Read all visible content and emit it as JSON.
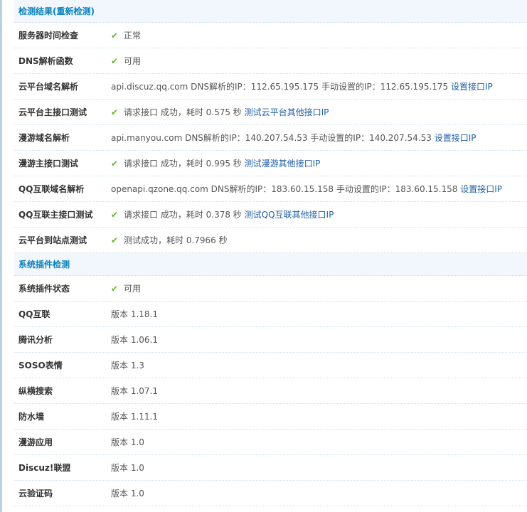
{
  "section1": {
    "title": "检测结果(重新检测)"
  },
  "rows1": [
    {
      "label": "服务器时间检查",
      "ok": true,
      "text": "正常"
    },
    {
      "label": "DNS解析函数",
      "ok": true,
      "text": "可用"
    },
    {
      "label": "云平台域名解析",
      "text": "api.discuz.qq.com DNS解析的IP：112.65.195.175 手动设置的IP：112.65.195.175",
      "link": "设置接口IP"
    },
    {
      "label": "云平台主接口测试",
      "ok": true,
      "text": "请求接口 成功，耗时 0.575 秒",
      "link": "测试云平台其他接口IP"
    },
    {
      "label": "漫游域名解析",
      "text": "api.manyou.com DNS解析的IP：140.207.54.53 手动设置的IP：140.207.54.53",
      "link": "设置接口IP"
    },
    {
      "label": "漫游主接口测试",
      "ok": true,
      "text": "请求接口 成功，耗时 0.995 秒",
      "link": "测试漫游其他接口IP"
    },
    {
      "label": "QQ互联域名解析",
      "text": "openapi.qzone.qq.com DNS解析的IP：183.60.15.158 手动设置的IP：183.60.15.158",
      "link": "设置接口IP"
    },
    {
      "label": "QQ互联主接口测试",
      "ok": true,
      "text": "请求接口 成功，耗时 0.378 秒",
      "link": "测试QQ互联其他接口IP"
    },
    {
      "label": "云平台到站点测试",
      "ok": true,
      "text": "测试成功，耗时 0.7966 秒"
    }
  ],
  "section2": {
    "title": "系统插件检测"
  },
  "rows2": [
    {
      "label": "系统插件状态",
      "ok": true,
      "text": "可用"
    },
    {
      "label": "QQ互联",
      "text": "版本 1.18.1"
    },
    {
      "label": "腾讯分析",
      "text": "版本 1.06.1"
    },
    {
      "label": "SOSO表情",
      "text": "版本 1.3"
    },
    {
      "label": "纵横搜索",
      "text": "版本 1.07.1"
    },
    {
      "label": "防水墙",
      "text": "版本 1.11.1"
    },
    {
      "label": "漫游应用",
      "text": "版本 1.0"
    },
    {
      "label": "Discuz!联盟",
      "text": "版本 1.0"
    },
    {
      "label": "云验证码",
      "text": "版本 1.0"
    }
  ]
}
